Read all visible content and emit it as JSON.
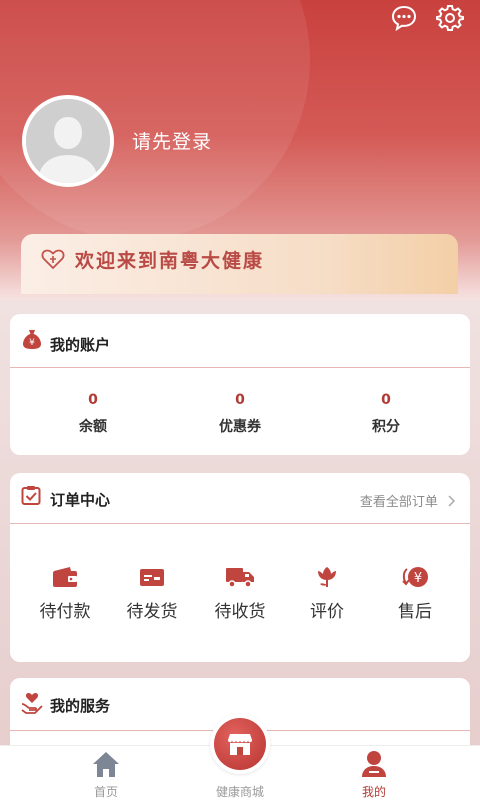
{
  "header": {
    "login_prompt": "请先登录",
    "welcome": "欢迎来到南粤大健康"
  },
  "account": {
    "title": "我的账户",
    "stats": [
      {
        "value": "0",
        "label": "余额"
      },
      {
        "value": "0",
        "label": "优惠券"
      },
      {
        "value": "0",
        "label": "积分"
      }
    ]
  },
  "orders": {
    "title": "订单中心",
    "view_all": "查看全部订单",
    "items": [
      {
        "label": "待付款",
        "icon": "wallet-icon"
      },
      {
        "label": "待发货",
        "icon": "card-icon"
      },
      {
        "label": "待收货",
        "icon": "truck-icon"
      },
      {
        "label": "评价",
        "icon": "flower-icon"
      },
      {
        "label": "售后",
        "icon": "yen-return-icon"
      }
    ]
  },
  "services": {
    "title": "我的服务"
  },
  "tabbar": {
    "home": "首页",
    "mall": "健康商城",
    "mine": "我的"
  },
  "colors": {
    "accent": "#b23a35",
    "header_top": "#c9413e",
    "welcome_text": "#b94a45"
  }
}
